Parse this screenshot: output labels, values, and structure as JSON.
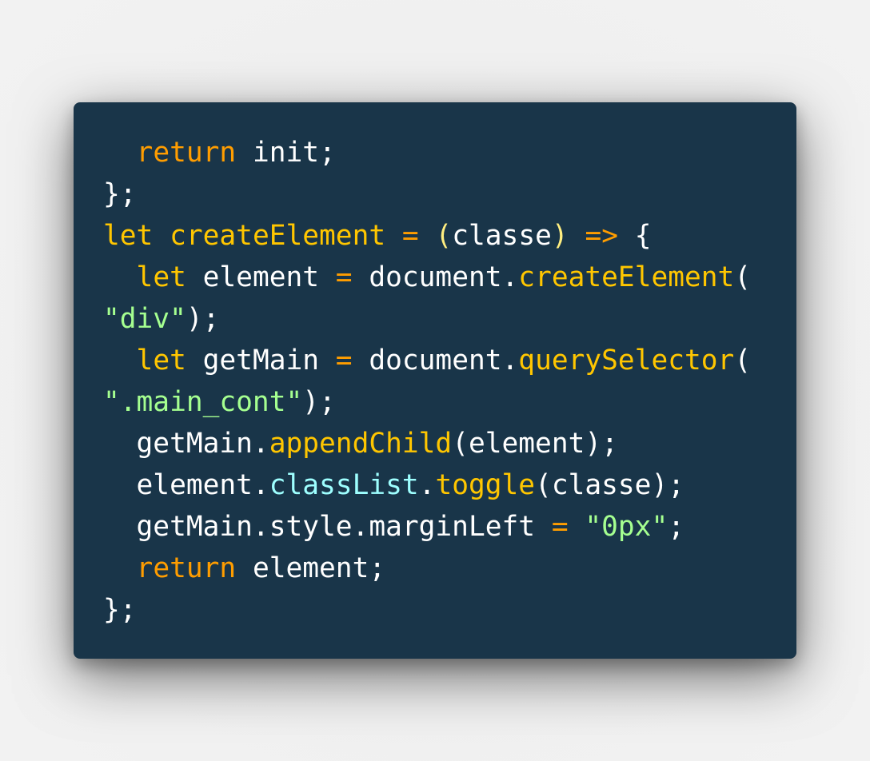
{
  "colors": {
    "background": "#193549",
    "plain": "#ffffff",
    "keyword": "#ff9d00",
    "function": "#ffc600",
    "string": "#a5ff90",
    "property": "#9effff",
    "paren": "#ffee80"
  },
  "code_lines": [
    [
      {
        "t": "  "
      },
      {
        "t": "return",
        "c": "keyword"
      },
      {
        "t": " init;"
      }
    ],
    [
      {
        "t": "};"
      }
    ],
    [
      {
        "t": "let",
        "c": "function"
      },
      {
        "t": " "
      },
      {
        "t": "createElement",
        "c": "function"
      },
      {
        "t": " "
      },
      {
        "t": "=",
        "c": "keyword"
      },
      {
        "t": " "
      },
      {
        "t": "(",
        "c": "paren"
      },
      {
        "t": "classe"
      },
      {
        "t": ")",
        "c": "paren"
      },
      {
        "t": " "
      },
      {
        "t": "=>",
        "c": "keyword"
      },
      {
        "t": " {"
      }
    ],
    [
      {
        "t": "  "
      },
      {
        "t": "let",
        "c": "function"
      },
      {
        "t": " element "
      },
      {
        "t": "=",
        "c": "keyword"
      },
      {
        "t": " document."
      },
      {
        "t": "createElement",
        "c": "function"
      },
      {
        "t": "("
      }
    ],
    [
      {
        "t": "\"div\"",
        "c": "string"
      },
      {
        "t": ");"
      }
    ],
    [
      {
        "t": "  "
      },
      {
        "t": "let",
        "c": "function"
      },
      {
        "t": " getMain "
      },
      {
        "t": "=",
        "c": "keyword"
      },
      {
        "t": " document."
      },
      {
        "t": "querySelector",
        "c": "function"
      },
      {
        "t": "("
      }
    ],
    [
      {
        "t": "\".main_cont\"",
        "c": "string"
      },
      {
        "t": ");"
      }
    ],
    [
      {
        "t": "  getMain."
      },
      {
        "t": "appendChild",
        "c": "function"
      },
      {
        "t": "(element);"
      }
    ],
    [
      {
        "t": "  element."
      },
      {
        "t": "classList",
        "c": "property"
      },
      {
        "t": "."
      },
      {
        "t": "toggle",
        "c": "function"
      },
      {
        "t": "(classe);"
      }
    ],
    [
      {
        "t": "  getMain.style.marginLeft "
      },
      {
        "t": "=",
        "c": "keyword"
      },
      {
        "t": " "
      },
      {
        "t": "\"0px\"",
        "c": "string"
      },
      {
        "t": ";"
      }
    ],
    [
      {
        "t": "  "
      },
      {
        "t": "return",
        "c": "keyword"
      },
      {
        "t": " element;"
      }
    ],
    [
      {
        "t": "};"
      }
    ]
  ]
}
